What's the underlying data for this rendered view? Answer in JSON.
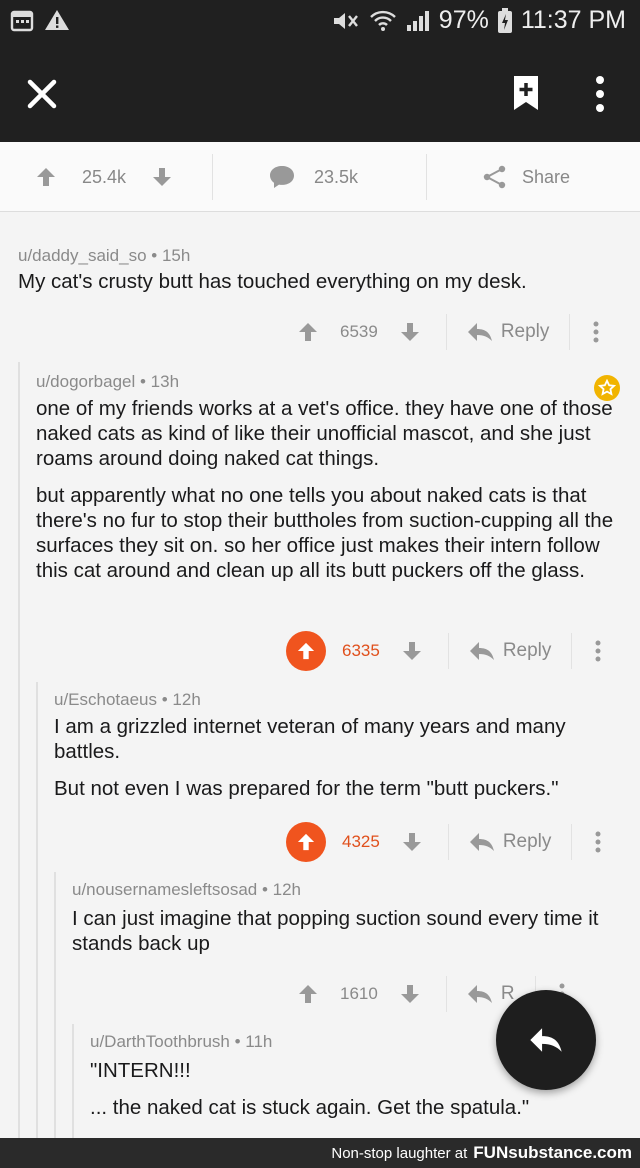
{
  "status_bar": {
    "battery": "97%",
    "time": "11:37 PM",
    "icons": [
      "calendar-icon",
      "warning-icon",
      "mute-icon",
      "wifi-icon",
      "signal-icon",
      "battery-icon"
    ]
  },
  "app_bar": {
    "icons": [
      "close-icon",
      "bookmark-add-icon",
      "more-vertical-icon"
    ]
  },
  "post_bar": {
    "votes": "25.4k",
    "comments": "23.5k",
    "share_label": "Share"
  },
  "comments": [
    {
      "author": "u/daddy_said_so",
      "age": "15h",
      "paragraphs": [
        "My cat's crusty butt has touched everything on my desk."
      ],
      "score": "6539",
      "upvoted": false,
      "reply_label": "Reply"
    },
    {
      "author": "u/dogorbagel",
      "age": "13h",
      "paragraphs": [
        "one of my friends works at a vet's office. they have one of those naked cats as kind of like their unofficial mascot, and she just roams around doing naked cat things.",
        "but apparently what no one tells you about naked cats is that there's no fur to stop their buttholes from suction-cupping all the surfaces they sit on. so her office just makes their intern follow this cat around and clean up all its butt puckers off the glass."
      ],
      "score": "6335",
      "upvoted": true,
      "reply_label": "Reply"
    },
    {
      "author": "u/Eschotaeus",
      "age": "12h",
      "paragraphs": [
        "I am a grizzled internet veteran of many years and many battles.",
        "But not even I was prepared for the term \"butt puckers.\""
      ],
      "score": "4325",
      "upvoted": true,
      "reply_label": "Reply"
    },
    {
      "author": "u/nousernamesleftsosad",
      "age": "12h",
      "paragraphs": [
        "I can just imagine that popping suction sound every time it stands back up"
      ],
      "score": "1610",
      "upvoted": false,
      "reply_label": "R"
    },
    {
      "author": "u/DarthToothbrush",
      "age": "11h",
      "paragraphs": [
        "\"INTERN!!!",
        "... the naked cat is stuck again. Get the spatula.\""
      ]
    }
  ],
  "footer": {
    "tagline": "Non-stop laughter at",
    "brand": "FUNsubstance.com"
  },
  "colors": {
    "upvote": "#f0541e",
    "app_bar": "#202020",
    "award": "#f1b400"
  }
}
